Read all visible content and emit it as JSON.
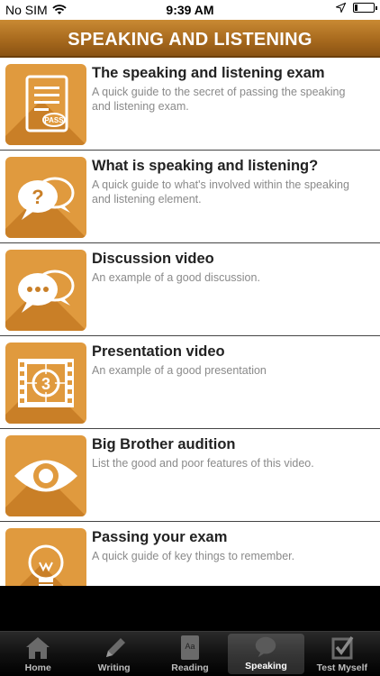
{
  "status_bar": {
    "carrier": "No SIM",
    "time": "9:39 AM"
  },
  "header": {
    "title": "SPEAKING AND LISTENING"
  },
  "items": [
    {
      "title": "The speaking and listening exam",
      "description": "A quick guide to the secret of passing the speaking and listening exam.",
      "icon": "document-pass-icon"
    },
    {
      "title": "What is speaking and listening?",
      "description": "A quick guide to what's involved within the speaking and listening element.",
      "icon": "question-speech-bubbles-icon"
    },
    {
      "title": "Discussion video",
      "description": "An example of a good discussion.",
      "icon": "chat-bubbles-icon"
    },
    {
      "title": "Presentation video",
      "description": "An example of a good presentation",
      "icon": "film-countdown-icon"
    },
    {
      "title": "Big Brother audition",
      "description": "List the good and poor features of this video.",
      "icon": "eye-icon"
    },
    {
      "title": "Passing your exam",
      "description": "A quick guide of key things to remember.",
      "icon": "lightbulb-icon"
    }
  ],
  "document_icon_text": "PASS",
  "film_icon_number": "3",
  "tabs": [
    {
      "label": "Home",
      "icon": "house-icon",
      "active": false
    },
    {
      "label": "Writing",
      "icon": "pencil-icon",
      "active": false
    },
    {
      "label": "Reading",
      "icon": "book-icon",
      "active": false
    },
    {
      "label": "Speaking",
      "icon": "speech-icon",
      "active": true
    },
    {
      "label": "Test Myself",
      "icon": "checkbox-icon",
      "active": false
    }
  ],
  "tab_reading_icon_text": "Aa",
  "colors": {
    "accent": "#e09a3e",
    "accent_shadow": "#c97f27",
    "header": "#a86a1e"
  }
}
